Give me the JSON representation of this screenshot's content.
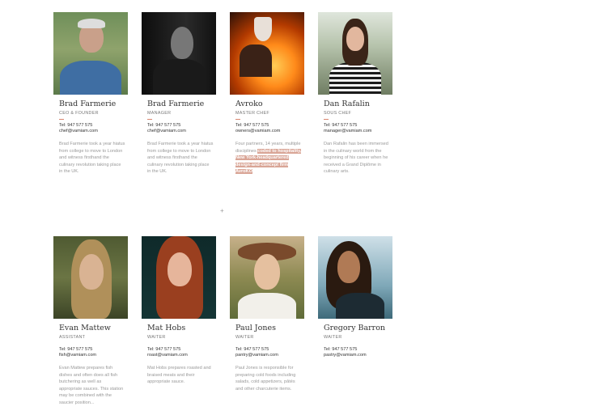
{
  "team": [
    {
      "name": "Brad Farmerie",
      "role": "CEO & FOUNDER",
      "tel": "Tel: 947 577 575",
      "email": "chef@vamiam.com",
      "desc": "Brad Farmerie took a year hiatus from college to move to London and witness firsthand the culinary revolution taking place in the UK.",
      "highlight": ""
    },
    {
      "name": "Brad Farmerie",
      "role": "MANAGER",
      "tel": "Tel: 947 577 575",
      "email": "chef@vamiam.com",
      "desc": "Brad Farmerie took a year hiatus from college to move to London and witness firsthand the culinary revolution taking place in the UK.",
      "highlight": ""
    },
    {
      "name": "Avroko",
      "role": "MASTER CHEF",
      "tel": "Tel: 947 577 575",
      "email": "owners@vamiam.com",
      "desc": "Four partners, 14 years, multiple disciplines ",
      "highlight": "coded to hospitality, New York-headquartered design-and-concept firm AvroKO"
    },
    {
      "name": "Dan Rafalin",
      "role": "SOUS CHEF",
      "tel": "Tel: 947 577 575",
      "email": "manager@vamiam.com",
      "desc": "Dan Rafalin has been immersed in the culinary world from the beginning of his career when he received a Grand Diplôme in culinary arts.",
      "highlight": ""
    },
    {
      "name": "Evan Mattew",
      "role": "ASSISTANT",
      "tel": "Tel: 947 577 575",
      "email": "fish@vamiam.com",
      "desc": "Evan Mattew prepares fish dishes and often does all fish butchering as well as appropriate sauces. This station may be combined with the saucier position...",
      "highlight": ""
    },
    {
      "name": "Mat Hobs",
      "role": "WAITER",
      "tel": "Tel: 947 577 575",
      "email": "roast@vamiam.com",
      "desc": "Mat Hobs prepares roasted and braised meats and their appropriate sauce.",
      "highlight": ""
    },
    {
      "name": "Paul Jones",
      "role": "WAITER",
      "tel": "Tel: 947 577 575",
      "email": "pantry@vamiam.com",
      "desc": "Paul Jones is responsible for preparing cold foods including salads, cold appetizers, pâtés and other charcuterie items.",
      "highlight": ""
    },
    {
      "name": "Gregory Barron",
      "role": "WAITER",
      "tel": "Tel: 947 577 575",
      "email": "pastry@vamiam.com",
      "desc": "",
      "highlight": ""
    }
  ],
  "divider_glyph": "+"
}
